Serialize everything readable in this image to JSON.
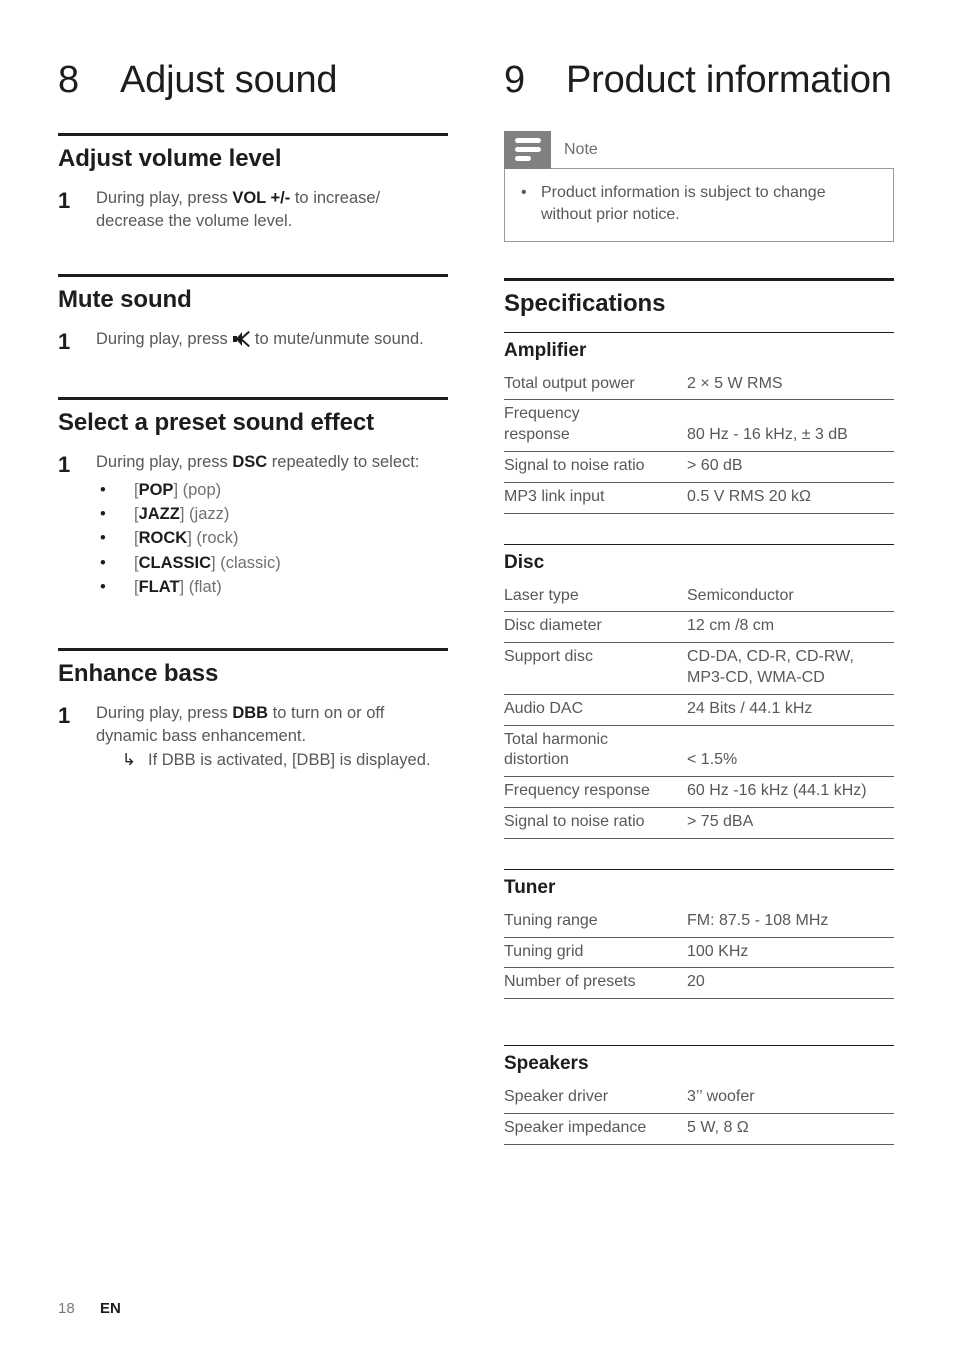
{
  "footer": {
    "page_number": "18",
    "language": "EN"
  },
  "left_column": {
    "chapter": {
      "number": "8",
      "title": "Adjust sound"
    },
    "sections": [
      {
        "heading": "Adjust volume level",
        "step_number": "1",
        "text_before": "During play, press ",
        "bold": "VOL +/-",
        "text_after": " to increase/ decrease the volume level."
      },
      {
        "heading": "Mute sound",
        "step_number": "1",
        "text_before": "During play, press ",
        "icon": "mute-icon",
        "text_after": " to mute/unmute sound."
      },
      {
        "heading": "Select a preset sound effect",
        "step_number": "1",
        "text_before": "During play, press ",
        "bold": "DSC",
        "text_after": " repeatedly to select:",
        "bullets": [
          {
            "bracket_open": "[",
            "code": "POP",
            "bracket_close": "]",
            "desc": "(pop)"
          },
          {
            "bracket_open": "[",
            "code": "JAZZ",
            "bracket_close": "]",
            "desc": "(jazz)"
          },
          {
            "bracket_open": "[",
            "code": "ROCK",
            "bracket_close": "]",
            "desc": "(rock)"
          },
          {
            "bracket_open": "[",
            "code": "CLASSIC",
            "bracket_close": "]",
            "desc": "(classic)"
          },
          {
            "bracket_open": "[",
            "code": "FLAT",
            "bracket_close": "]",
            "desc": "(flat)"
          }
        ]
      },
      {
        "heading": "Enhance bass",
        "step_number": "1",
        "text_before": "During play, press ",
        "bold": "DBB",
        "text_after": " to turn on or off dynamic bass enhancement.",
        "subnote_arrow": "↳",
        "subnote": "If DBB is activated, [DBB] is displayed."
      }
    ]
  },
  "right_column": {
    "chapter": {
      "number": "9",
      "title": "Product information"
    },
    "note": {
      "title": "Note",
      "icon": "note-lines-icon",
      "bullet": "•",
      "items": [
        "Product information is subject to change without prior notice."
      ]
    },
    "specifications_heading": "Specifications",
    "tables": [
      {
        "name": "Amplifier",
        "rows": [
          {
            "key": "Total output power",
            "value": "2 × 5 W RMS"
          },
          {
            "key": "Frequency",
            "key2": "response",
            "value": "",
            "value2": "80 Hz - 16 kHz, ± 3 dB",
            "two_line": true
          },
          {
            "key": "Signal to noise ratio",
            "value": "> 60 dB"
          },
          {
            "key": "MP3 link input",
            "value": "0.5 V RMS 20 kΩ"
          }
        ]
      },
      {
        "name": "Disc",
        "rows": [
          {
            "key": "Laser type",
            "value": "Semiconductor"
          },
          {
            "key": "Disc diameter",
            "value": "12 cm /8 cm"
          },
          {
            "key": "Support disc",
            "value": "CD-DA, CD-R, CD-RW,",
            "value2": "MP3-CD, WMA-CD",
            "two_line_value": true
          },
          {
            "key": "Audio DAC",
            "value": "24 Bits / 44.1 kHz"
          },
          {
            "key": "Total harmonic",
            "key2": "distortion",
            "value": "",
            "value2": "< 1.5%",
            "two_line": true
          },
          {
            "key": "Frequency response",
            "value": "60 Hz -16 kHz (44.1 kHz)"
          },
          {
            "key": "Signal to noise ratio",
            "value": "> 75 dBA"
          }
        ]
      },
      {
        "name": "Tuner",
        "rows": [
          {
            "key": "Tuning range",
            "value": "FM: 87.5 - 108 MHz"
          },
          {
            "key": "Tuning grid",
            "value": "100 KHz"
          },
          {
            "key": "Number of presets",
            "value": "20"
          }
        ]
      },
      {
        "name": "Speakers",
        "rows": [
          {
            "key": "Speaker driver",
            "value": "3’’ woofer"
          },
          {
            "key": "Speaker impedance",
            "value": "5 W, 8 Ω"
          }
        ]
      }
    ]
  },
  "colors": {
    "ink": "#1d1d1b",
    "body": "#58585a",
    "note_gray": "#808083",
    "rule": "#5a5a5c"
  }
}
